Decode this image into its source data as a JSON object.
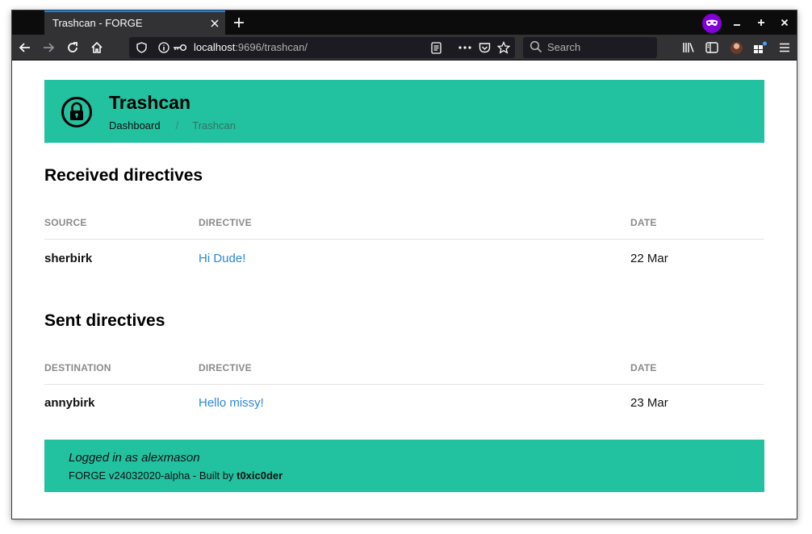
{
  "browser": {
    "tab_title": "Trashcan - FORGE",
    "url_host": "localhost",
    "url_rest": ":9696/trashcan/",
    "search_placeholder": "Search"
  },
  "header": {
    "title": "Trashcan",
    "breadcrumbs": [
      "Dashboard",
      "/",
      "Trashcan"
    ]
  },
  "received": {
    "title": "Received directives",
    "columns": [
      "SOURCE",
      "DIRECTIVE",
      "DATE"
    ],
    "rows": [
      {
        "source": "sherbirk",
        "directive": "Hi Dude!",
        "date": "22 Mar"
      }
    ]
  },
  "sent": {
    "title": "Sent directives",
    "columns": [
      "DESTINATION",
      "DIRECTIVE",
      "DATE"
    ],
    "rows": [
      {
        "destination": "annybirk",
        "directive": "Hello missy!",
        "date": "23 Mar"
      }
    ]
  },
  "footer": {
    "logged_in": "Logged in as alexmason",
    "build_prefix": "FORGE v24032020-alpha - Built by ",
    "author": "t0xic0der"
  },
  "colors": {
    "accent": "#22c1a0",
    "link": "#2c87d8",
    "private_badge": "#8000d7"
  }
}
